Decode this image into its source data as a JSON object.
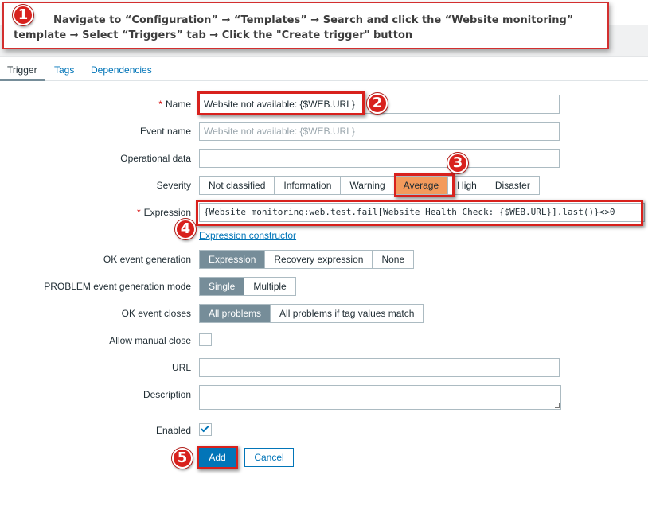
{
  "instruction": {
    "text": "Navigate to “Configuration” → “Templates” → Search and click the “Website monitoring” template → Select “Triggers” tab → Click the \"Create trigger\" button"
  },
  "steps": [
    "1",
    "2",
    "3",
    "4",
    "5"
  ],
  "tabs": [
    "Trigger",
    "Tags",
    "Dependencies"
  ],
  "form": {
    "required_marker": "*",
    "name": {
      "label": "Name",
      "value": "Website not available: {$WEB.URL}"
    },
    "event_name": {
      "label": "Event name",
      "placeholder": "Website not available: {$WEB.URL}"
    },
    "operational_data": {
      "label": "Operational data",
      "value": ""
    },
    "severity": {
      "label": "Severity",
      "options": [
        "Not classified",
        "Information",
        "Warning",
        "Average",
        "High",
        "Disaster"
      ],
      "selected": "Average"
    },
    "expression": {
      "label": "Expression",
      "value": "{Website monitoring:web.test.fail[Website Health Check: {$WEB.URL}].last()}<>0"
    },
    "expression_constructor_link": "Expression constructor",
    "ok_event_generation": {
      "label": "OK event generation",
      "options": [
        "Expression",
        "Recovery expression",
        "None"
      ],
      "selected": "Expression"
    },
    "problem_mode": {
      "label": "PROBLEM event generation mode",
      "options": [
        "Single",
        "Multiple"
      ],
      "selected": "Single"
    },
    "ok_event_closes": {
      "label": "OK event closes",
      "options": [
        "All problems",
        "All problems if tag values match"
      ],
      "selected": "All problems"
    },
    "allow_manual_close": {
      "label": "Allow manual close",
      "checked": false
    },
    "url": {
      "label": "URL",
      "value": ""
    },
    "description": {
      "label": "Description",
      "value": ""
    },
    "enabled": {
      "label": "Enabled",
      "checked": true
    }
  },
  "buttons": {
    "add": "Add",
    "cancel": "Cancel"
  },
  "colors": {
    "highlight_red": "#d8211d",
    "link_blue": "#0275b8",
    "segment_selected": "#768d99",
    "severity_average": "#f39a5c"
  }
}
